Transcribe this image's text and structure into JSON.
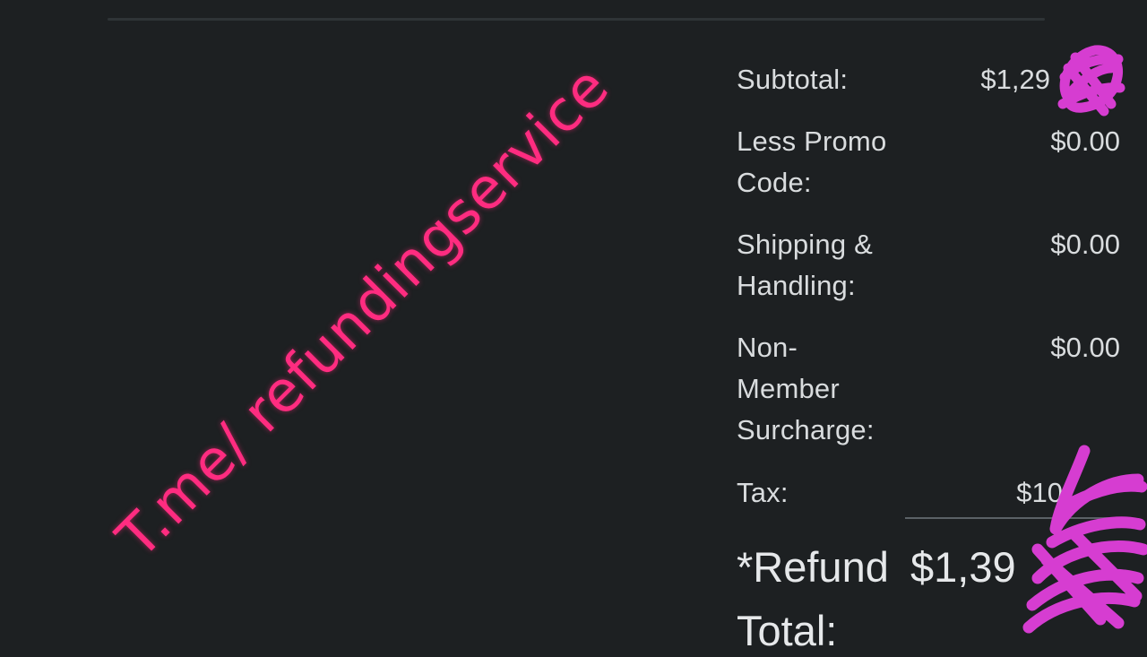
{
  "summary": {
    "subtotal": {
      "label": "Subtotal:",
      "value": "$1,29"
    },
    "promo": {
      "label": "Less Promo Code:",
      "value": "$0.00"
    },
    "shipping": {
      "label": "Shipping & Handling:",
      "value": "$0.00"
    },
    "surcharge": {
      "label": "Non-Member Surcharge:",
      "value": "$0.00"
    },
    "tax": {
      "label": "Tax:",
      "value": "$10"
    },
    "refund_total": {
      "label": "*Refund",
      "label_line2": "Total:",
      "value": "$1,39"
    }
  },
  "watermark": {
    "text": "T.me/ refundingservice",
    "color": "#ff2c80"
  },
  "redaction_color": "#d63dd1"
}
